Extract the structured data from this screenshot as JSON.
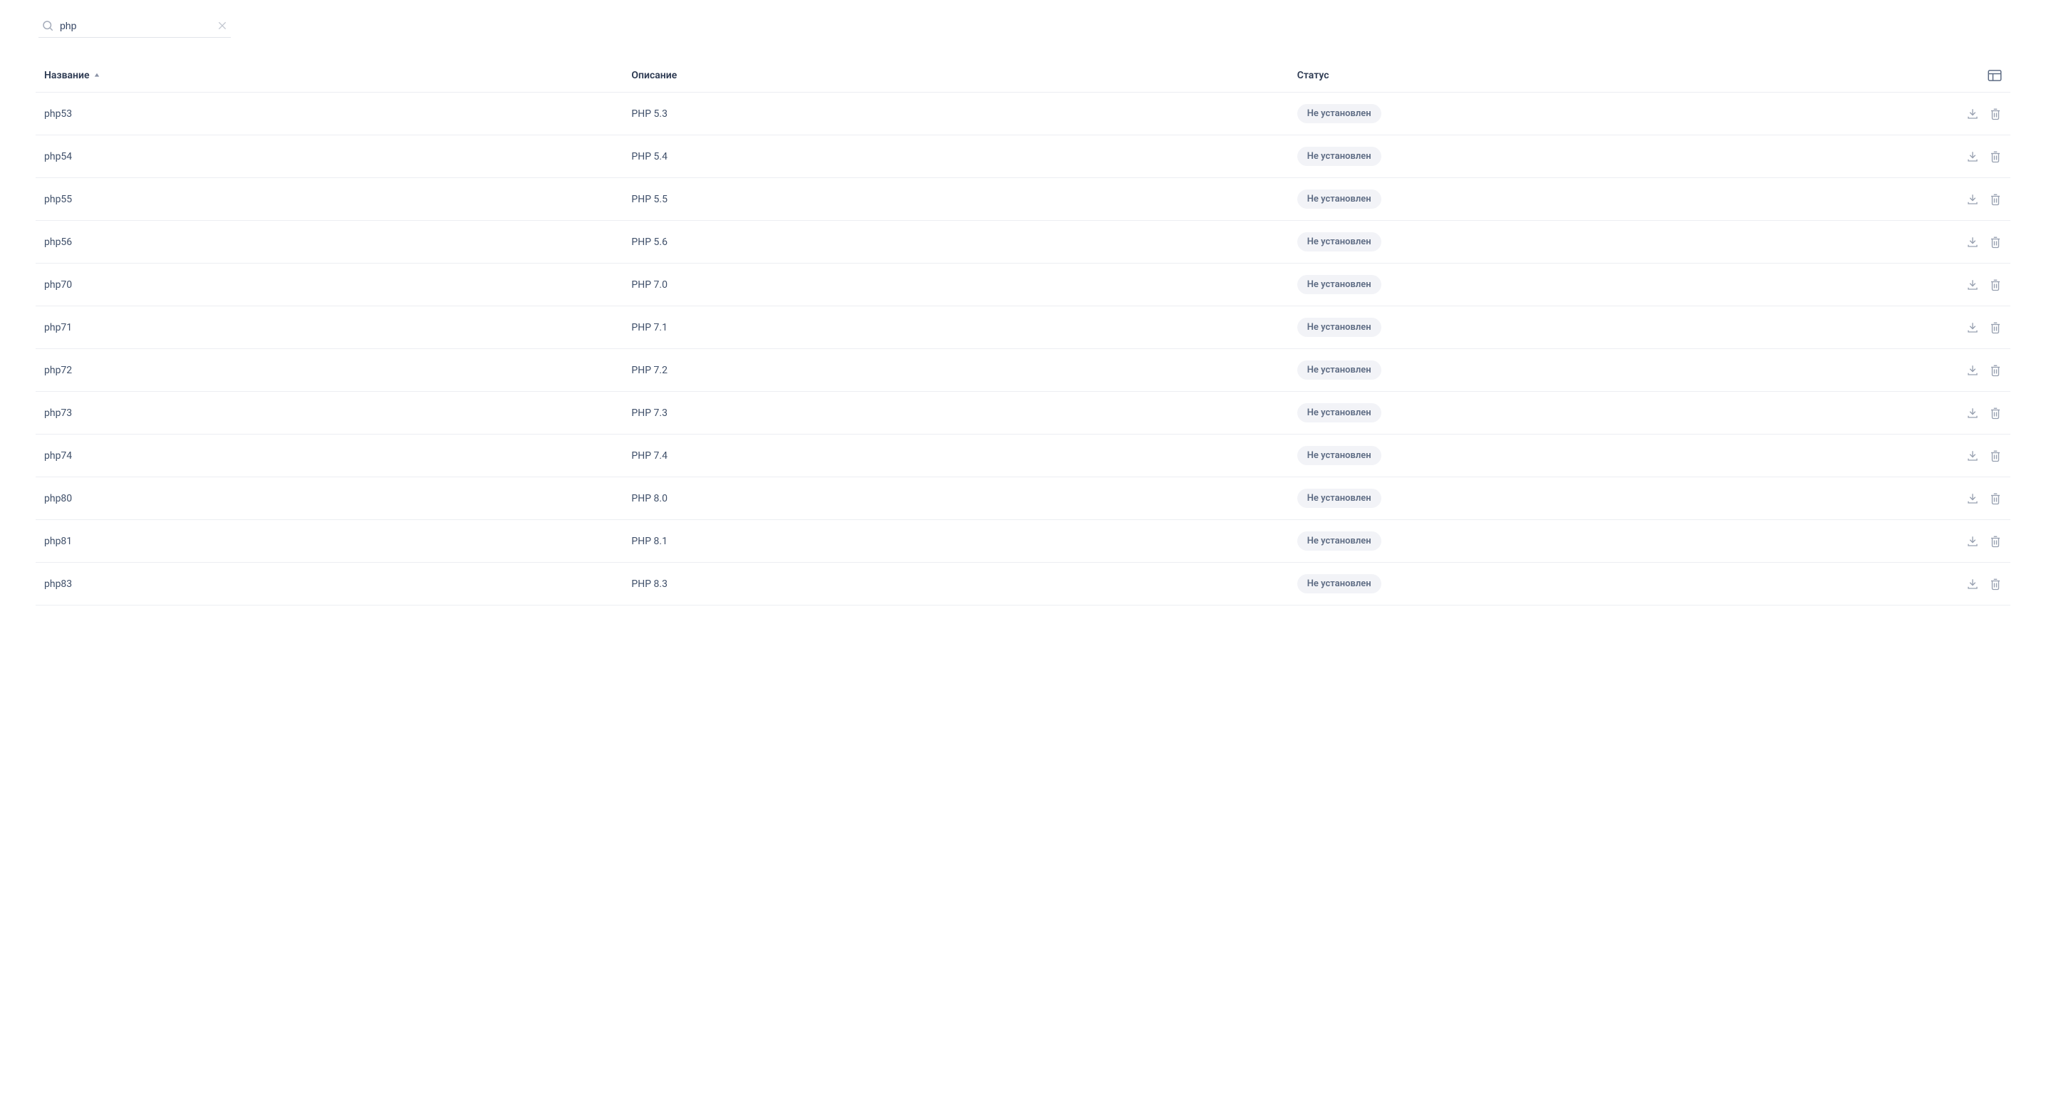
{
  "search": {
    "value": "php"
  },
  "columns": {
    "name": "Название",
    "description": "Описание",
    "status": "Статус"
  },
  "status_label": "Не установлен",
  "rows": [
    {
      "name": "php53",
      "description": "PHP 5.3"
    },
    {
      "name": "php54",
      "description": "PHP 5.4"
    },
    {
      "name": "php55",
      "description": "PHP 5.5"
    },
    {
      "name": "php56",
      "description": "PHP 5.6"
    },
    {
      "name": "php70",
      "description": "PHP 7.0"
    },
    {
      "name": "php71",
      "description": "PHP 7.1"
    },
    {
      "name": "php72",
      "description": "PHP 7.2"
    },
    {
      "name": "php73",
      "description": "PHP 7.3"
    },
    {
      "name": "php74",
      "description": "PHP 7.4"
    },
    {
      "name": "php80",
      "description": "PHP 8.0"
    },
    {
      "name": "php81",
      "description": "PHP 8.1"
    },
    {
      "name": "php83",
      "description": "PHP 8.3"
    }
  ]
}
